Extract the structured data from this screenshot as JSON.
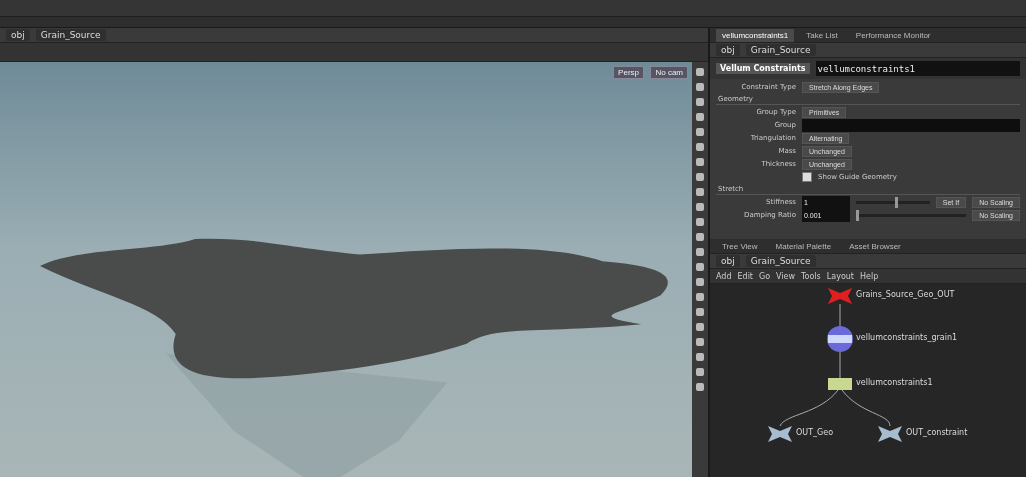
{
  "path_bar": {
    "items": [
      "obj",
      "Grain_Source"
    ]
  },
  "viewport": {
    "camera_menus": [
      "Persp",
      "No cam"
    ]
  },
  "parameter_tabs": [
    {
      "label": "vellumconstraints1",
      "selected": true
    },
    {
      "label": "Take List",
      "selected": false
    },
    {
      "label": "Performance Monitor",
      "selected": false
    }
  ],
  "parameter_path": {
    "items": [
      "obj",
      "Grain_Source"
    ]
  },
  "node_header": {
    "type": "Vellum Constraints",
    "name": "vellumconstraints1"
  },
  "parameters": {
    "constraint_type": {
      "label": "Constraint Type",
      "value": "Stretch Along Edges"
    },
    "sections": [
      {
        "title": "Geometry",
        "rows": [
          {
            "kind": "menu",
            "label": "Group Type",
            "value": "Primitives"
          },
          {
            "kind": "text",
            "label": "Group",
            "value": ""
          },
          {
            "kind": "menu",
            "label": "Triangulation",
            "value": "Alternating"
          },
          {
            "kind": "menu",
            "label": "Mass",
            "value": "Unchanged"
          },
          {
            "kind": "menu",
            "label": "Thickness",
            "value": "Unchanged"
          },
          {
            "kind": "check",
            "label": "Show Guide Geometry",
            "checked": true
          }
        ]
      },
      {
        "title": "Stretch",
        "rows": [
          {
            "kind": "slider",
            "label": "Stiffness",
            "value": "1",
            "level": 0.55,
            "mode": "Set If",
            "scaling": "No Scaling"
          },
          {
            "kind": "slider",
            "label": "Damping Ratio",
            "value": "0.001",
            "level": 0.0,
            "mode": "",
            "scaling": "No Scaling"
          }
        ]
      }
    ]
  },
  "network_tabs": [
    {
      "label": "Tree View",
      "selected": false
    },
    {
      "label": "Material Palette",
      "selected": false
    },
    {
      "label": "Asset Browser",
      "selected": false
    }
  ],
  "network_path": {
    "items": [
      "obj",
      "Grain_Source"
    ]
  },
  "network_menu": [
    "Add",
    "Edit",
    "Go",
    "View",
    "Tools",
    "Layout",
    "Help"
  ],
  "nodes": [
    {
      "kind": "null",
      "name": "Grains_Source_Geo_OUT",
      "color": "#e02020"
    },
    {
      "kind": "sphere",
      "name": "vellumconstraints_grain1",
      "color": "#6a6ad8"
    },
    {
      "kind": "box",
      "name": "vellumconstraints1",
      "color": "#c8d890"
    },
    {
      "kind": "null",
      "name": "OUT_Geo",
      "color": "#a8bcd0"
    },
    {
      "kind": "null",
      "name": "OUT_constraint",
      "color": "#a8bcd0"
    }
  ]
}
